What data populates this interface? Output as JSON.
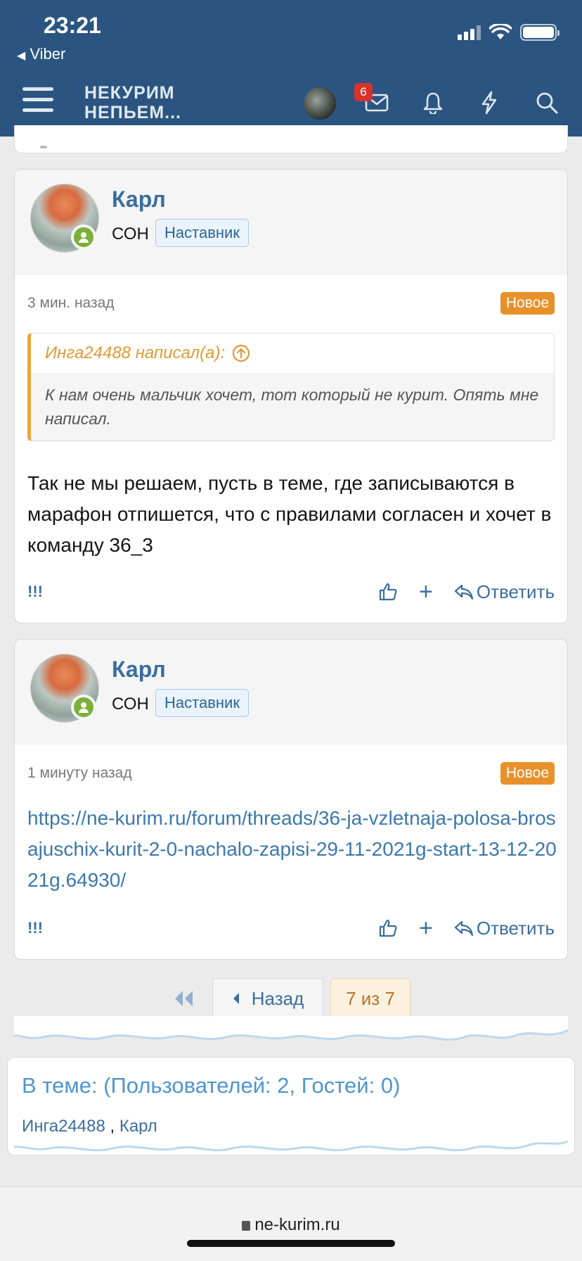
{
  "status_bar": {
    "time": "23:21",
    "back_app": "Viber"
  },
  "header": {
    "logo_line1": "НЕКУРИМ",
    "logo_line2": "НЕПЬЕМ...",
    "inbox_badge": "6",
    "colors": {
      "header_bg": "#2b5580",
      "link": "#3b6e9e",
      "new_badge": "#e8912a",
      "online": "#7bb13a"
    }
  },
  "posts": [
    {
      "username": "Карл",
      "user_title": "СОН",
      "role": "Наставник",
      "time": "3 мин. назад",
      "new_label": "Новое",
      "quote": {
        "author": "Инга24488 написал(а):",
        "text": "К нам очень мальчик хочет, тот который не курит. Опять мне написал."
      },
      "text": "Так не мы решаем, пусть в теме, где записываются в марафон отпишется, что с правилами согласен и хочет в команду 36_3",
      "actions": {
        "flag": "!!!",
        "reply": "Ответить"
      }
    },
    {
      "username": "Карл",
      "user_title": "СОН",
      "role": "Наставник",
      "time": "1 минуту назад",
      "new_label": "Новое",
      "link": "https://ne-kurim.ru/forum/threads/36-ja-vzletnaja-polosa-brosajuschix-kurit-2-0-nachalo-zapisi-29-11-2021g-start-13-12-2021g.64930/",
      "actions": {
        "flag": "!!!",
        "reply": "Ответить"
      }
    }
  ],
  "pagination": {
    "prev_label": "Назад",
    "current": "7 из 7"
  },
  "online": {
    "title": "В теме: (Пользователей: 2, Гостей: 0)",
    "users": [
      "Инга24488",
      "Карл"
    ],
    "separator": " , "
  },
  "browser": {
    "url": "ne-kurim.ru"
  }
}
